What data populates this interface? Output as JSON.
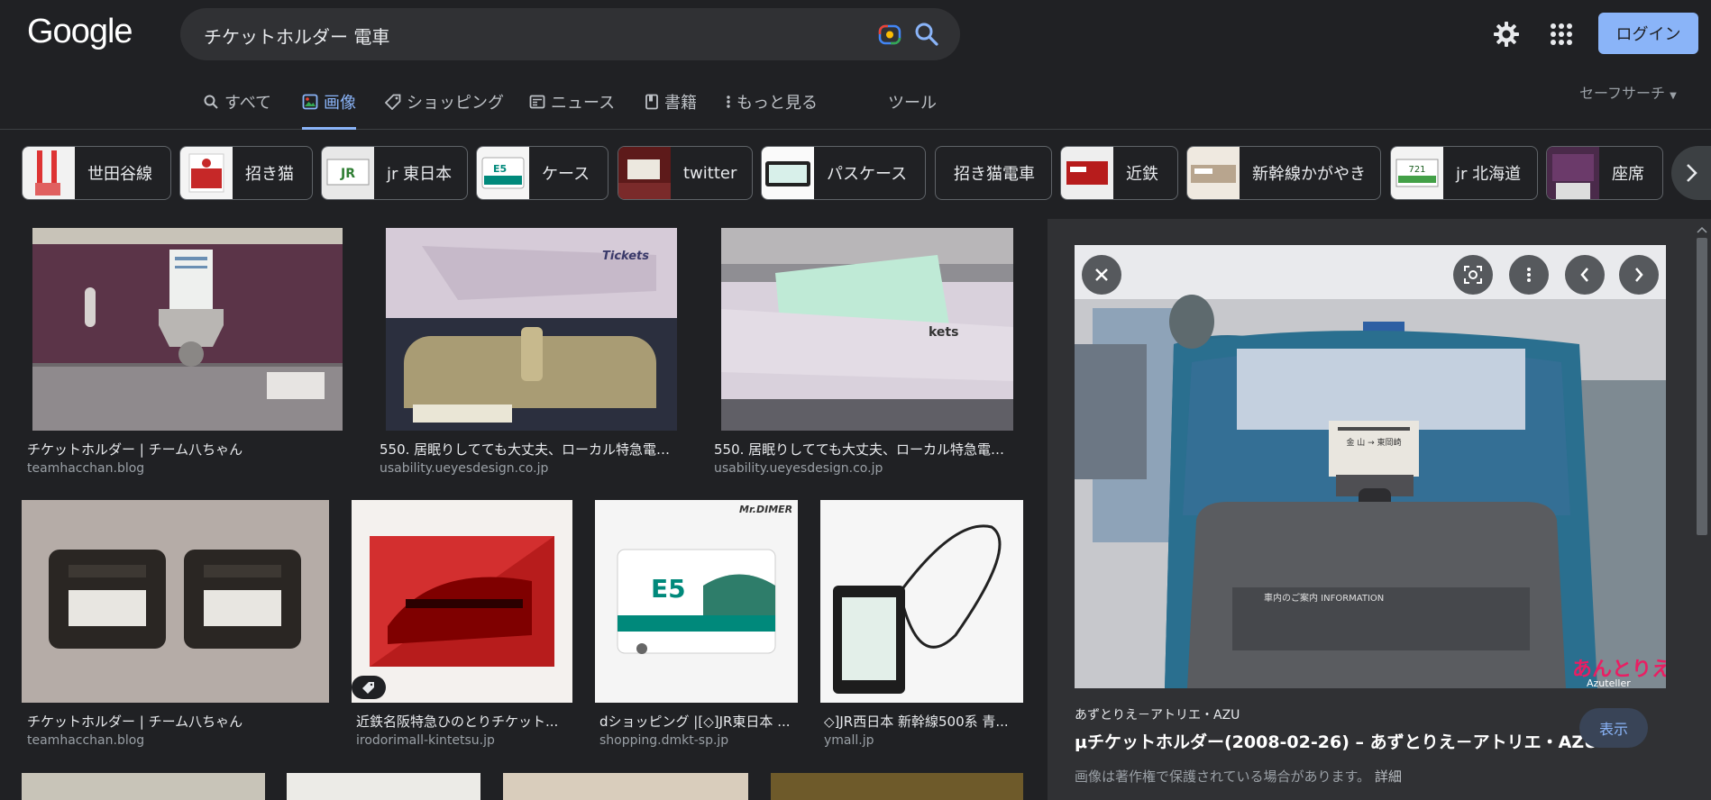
{
  "header": {
    "logo": "Google",
    "search_query": "チケットホルダー 電車",
    "login_label": "ログイン"
  },
  "tabs": [
    {
      "label": "すべて",
      "icon": "search-icon"
    },
    {
      "label": "画像",
      "icon": "image-icon",
      "active": true
    },
    {
      "label": "ショッピング",
      "icon": "tag-icon"
    },
    {
      "label": "ニュース",
      "icon": "news-icon"
    },
    {
      "label": "書籍",
      "icon": "book-icon"
    },
    {
      "label": "もっと見る",
      "icon": "more-vert-icon"
    }
  ],
  "tools_label": "ツール",
  "safesearch_label": "セーフサーチ",
  "chips": [
    {
      "label": "世田谷線"
    },
    {
      "label": "招き猫"
    },
    {
      "label": "jr 東日本"
    },
    {
      "label": "ケース"
    },
    {
      "label": "twitter"
    },
    {
      "label": "パスケース"
    },
    {
      "label": "招き猫電車"
    },
    {
      "label": "近鉄"
    },
    {
      "label": "新幹線かがやき"
    },
    {
      "label": "jr 北海道"
    },
    {
      "label": "座席"
    }
  ],
  "results": [
    {
      "title": "チケットホルダー | チーム八ちゃん",
      "site": "teamhacchan.blog"
    },
    {
      "title": "550. 居眠りしてても大丈夫、ローカル特急電車...",
      "site": "usability.ueyesdesign.co.jp"
    },
    {
      "title": "550. 居眠りしてても大丈夫、ローカル特急電車...",
      "site": "usability.ueyesdesign.co.jp"
    },
    {
      "title": "チケットホルダー | チーム八ちゃん",
      "site": "teamhacchan.blog"
    },
    {
      "title": "近鉄名阪特急ひのとりチケット...",
      "site": "irodorimall-kintetsu.jp"
    },
    {
      "title": "dショッピング |[◇]JR東日本 ...",
      "site": "shopping.dmkt-sp.jp"
    },
    {
      "title": "◇]JR西日本 新幹線500系 青...",
      "site": "ymall.jp"
    }
  ],
  "preview": {
    "source": "あずとりえ－アトリエ・AZU",
    "title": "μチケットホルダー(2008-02-26) – あずとりえ－アトリエ・AZU－",
    "view_label": "表示",
    "copyright_note": "画像は著作権で保護されている場合があります。",
    "detail_link": "詳細",
    "watermark": "あんとりえ",
    "watermark_sub": "Azuteller",
    "ticket_text": "金 山 → 東岡崎",
    "info_text": "車内のご案内 INFORMATION"
  },
  "colors": {
    "background": "#202124",
    "accent": "#8ab4f8",
    "surface": "#303134"
  }
}
